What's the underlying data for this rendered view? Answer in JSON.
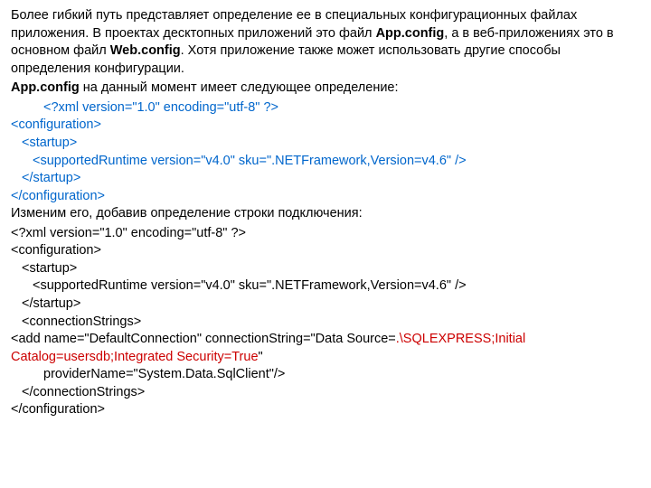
{
  "para1": {
    "pre": "Более гибкий путь представляет определение ее в специальных конфигурационных файлах приложения. В проектах десктопных приложений это файл ",
    "b1": "App.config",
    "mid": ", а в веб-приложениях это в основном файл ",
    "b2": "Web.config",
    "post": ". Хотя приложение также может использовать другие способы определения конфигурации."
  },
  "para2": {
    "b": "App.config",
    "rest": "  на данный момент имеет следующее определение:"
  },
  "code1": {
    "l1": "<?xml version=\"1.0\" encoding=\"utf-8\" ?>",
    "l2": "<configuration>",
    "l3": "<startup>",
    "l4": "<supportedRuntime version=\"v4.0\" sku=\".NETFramework,Version=v4.6\" />",
    "l5": "</startup>",
    "l6": "</configuration>"
  },
  "para3": "Изменим его, добавив определение строки подключения:",
  "code2": {
    "l1": "<?xml version=\"1.0\" encoding=\"utf-8\" ?>",
    "l2": "<configuration>",
    "l3": "<startup>",
    "l4": "<supportedRuntime version=\"v4.0\" sku=\".NETFramework,Version=v4.6\" />",
    "l5": "</startup>",
    "l6": "<connectionStrings>",
    "l7a": "<add name=\"DefaultConnection\" connectionString=\"Data Source=",
    "l7b": ".\\SQLEXPRESS;Initial Catalog=usersdb;Integrated Security=True",
    "l7c": "\"",
    "l8": "providerName=\"System.Data.SqlClient\"/>",
    "l9": "</connectionStrings>",
    "l10": "</configuration>"
  }
}
